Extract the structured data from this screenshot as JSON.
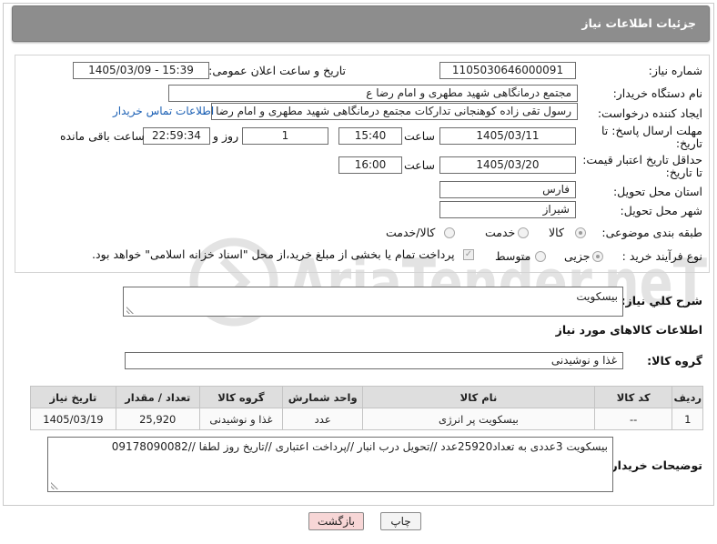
{
  "header": {
    "title": "جزئیات اطلاعات نیاز"
  },
  "fields": {
    "need_number_label": "شماره نیاز:",
    "need_number": "1105030646000091",
    "announce_label": "تاریخ و ساعت اعلان عمومی:",
    "announce_value": "1405/03/09 - 15:39",
    "buyer_org_label": "نام دستگاه خریدار:",
    "buyer_org": "مجتمع درمانگاهی شهید مطهری و امام رضا  ع",
    "requester_label": "ایجاد کننده درخواست:",
    "requester": "رسول تقی زاده کوهنجانی تدارکات مجتمع درمانگاهی شهید مطهری و امام رضا",
    "buyer_contact_link": "اطلاعات تماس خریدار",
    "deadline_label_1": "مهلت ارسال پاسخ: تا",
    "deadline_label_2": "تاریخ:",
    "deadline_date": "1405/03/11",
    "time_label": "ساعت",
    "deadline_time": "15:40",
    "days_value": "1",
    "days_label": "روز و",
    "remaining_time": "22:59:34",
    "remaining_label": "ساعت باقی مانده",
    "min_validity_label_1": "حداقل تاریخ اعتبار قیمت:",
    "min_validity_label_2": "تا تاریخ:",
    "validity_date": "1405/03/20",
    "validity_time": "16:00",
    "province_label": "استان محل تحویل:",
    "province": "فارس",
    "city_label": "شهر محل تحویل:",
    "city": "شیراز",
    "category_label": "طبقه بندی موضوعی:",
    "category_options": [
      "کالا",
      "خدمت",
      "کالا/خدمت"
    ],
    "process_label": "نوع فرآیند خرید :",
    "process_options": [
      "جزیی",
      "متوسط"
    ],
    "payment_note": "پرداخت تمام یا بخشی از مبلغ خرید،از محل \"اسناد خزانه اسلامی\" خواهد بود."
  },
  "summary": {
    "label": "شرح کلي نياز:",
    "value": "بیسکویت"
  },
  "goods_info": {
    "title": "اطلاعات کالاهای مورد نیاز",
    "group_label": "گروه کالا:",
    "group_value": "غذا و نوشیدنی"
  },
  "table": {
    "headers": [
      "ردیف",
      "کد کالا",
      "نام کالا",
      "واحد شمارش",
      "گروه کالا",
      "تعداد / مقدار",
      "تاریخ نیاز"
    ],
    "rows": [
      [
        "1",
        "--",
        "بیسکویت پر انرژی",
        "عدد",
        "غذا و نوشیدنی",
        "25,920",
        "1405/03/19"
      ]
    ]
  },
  "buyer_notes": {
    "label": "توضیحات خریدار:",
    "value": "بیسکویت 3عددی به تعداد25920عدد //تحویل درب انبار //پرداخت اعتباری //تاریخ روز لطفا //09178090082"
  },
  "buttons": {
    "print": "چاپ",
    "back": "بازگشت"
  },
  "watermark": "AriaTender.neT",
  "colors": {
    "header": "#8d8d8d",
    "link": "#1a5fb4",
    "back_button": "#f7d6d6",
    "watermark": "#cfcfcf"
  }
}
